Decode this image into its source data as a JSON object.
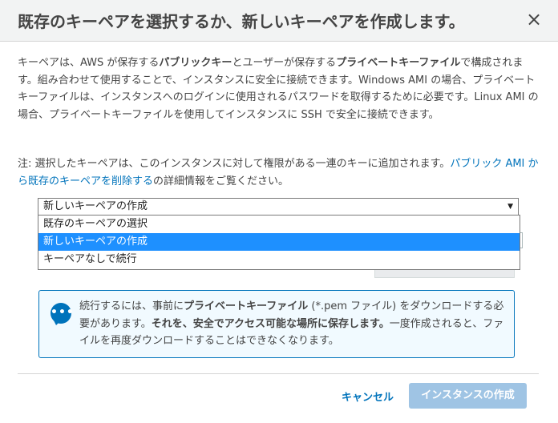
{
  "dialog": {
    "title": "既存のキーペアを選択するか、新しいキーペアを作成します。",
    "close_glyph": "×"
  },
  "intro": {
    "p1": "キーペアは、AWS が保存する",
    "p1_bold1": "パブリックキー",
    "p2": "とユーザーが保存する",
    "p2_bold2": "プライベートキーファイル",
    "p3": "で構成されます。組み合わせて使用することで、インスタンスに安全に接続できます。Windows AMI の場合、プライベートキーファイルは、インスタンスへのログインに使用されるパスワードを取得するために必要です。Linux AMI の場合、プライベートキーファイルを使用してインスタンスに SSH で安全に接続できます。"
  },
  "note": {
    "prefix": "注: 選択したキーペアは、このインスタンスに対して権限がある一連のキーに追加されます。",
    "link": "パブリック AMI から既存のキーペアを削除する",
    "suffix": "の詳細情報をご覧ください。"
  },
  "keypair_select": {
    "value": "新しいキーペアの作成",
    "arrow": "▼",
    "options": [
      {
        "label": "既存のキーペアの選択"
      },
      {
        "label": "新しいキーペアの作成"
      },
      {
        "label": "キーペアなしで続行"
      }
    ]
  },
  "info": {
    "icon": "chat-bubble-icon",
    "t1": "続行するには、事前に",
    "t1_bold": "プライベートキーファイル",
    "t2": " (*.pem ファイル) をダウンロードする必要があります。",
    "t2_bold": "それを、安全でアクセス可能な場所に保存します。",
    "t3": "一度作成されると、ファイルを再度ダウンロードすることはできなくなります。"
  },
  "footer": {
    "cancel_label": "キャンセル",
    "create_label": "インスタンスの作成"
  },
  "colors": {
    "link": "#0073bb",
    "selected_option": "#1e90ff",
    "primary_disabled": "#9fc4e4",
    "info_border": "#0073bb"
  }
}
